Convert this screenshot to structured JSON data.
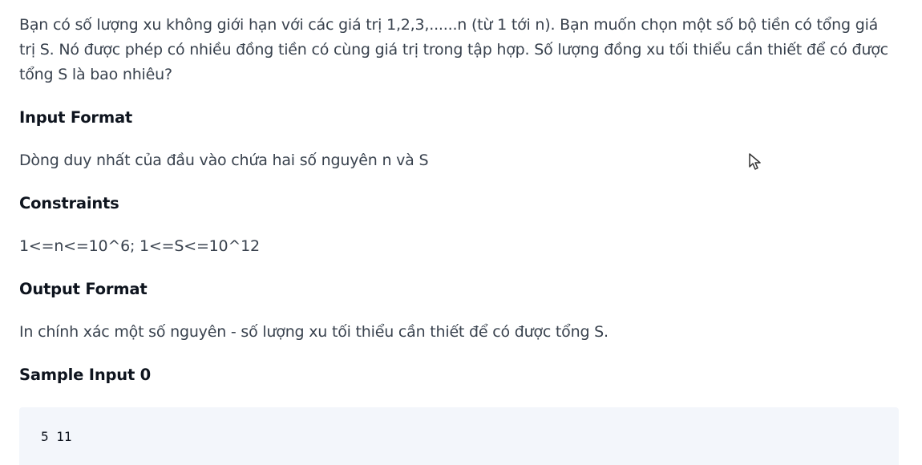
{
  "problem": {
    "intro": "Bạn có số lượng xu không giới hạn với các giá trị 1,2,3,......n (từ 1 tới n). Bạn muốn chọn một số bộ tiền có tổng giá trị S. Nó được phép có nhiều đồng tiền có cùng giá trị trong tập hợp. Số lượng đồng xu tối thiểu cần thiết để có được tổng S là bao nhiêu?",
    "input_format_heading": "Input Format",
    "input_format_text": "Dòng duy nhất của đầu vào chứa hai số nguyên n và S",
    "constraints_heading": "Constraints",
    "constraints_text": "1<=n<=10^6; 1<=S<=10^12",
    "output_format_heading": "Output Format",
    "output_format_text": "In chính xác một số nguyên - số lượng xu tối thiểu cần thiết để có được tổng S.",
    "sample_input_heading": "Sample Input 0",
    "sample_input_value": "5 11"
  },
  "icons": {
    "cursor": "mouse-pointer-icon"
  },
  "colors": {
    "text": "#39424e",
    "heading": "#0e141e",
    "code_background": "#f3f6fb"
  }
}
